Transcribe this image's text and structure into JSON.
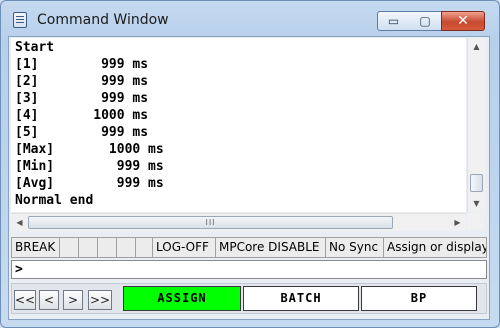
{
  "window": {
    "title": "Command Window",
    "controls": {
      "minimize": "▭",
      "maximize": "▢",
      "close": "✕"
    }
  },
  "output": {
    "lines": [
      "Start",
      "[1]        999 ms",
      "[2]        999 ms",
      "[3]        999 ms",
      "[4]       1000 ms",
      "[5]        999 ms",
      "[Max]       1000 ms",
      "[Min]        999 ms",
      "[Avg]        999 ms",
      "Normal end"
    ]
  },
  "scrollbars": {
    "up_arrow": "▲",
    "down_arrow": "▼",
    "left_arrow": "◀",
    "right_arrow": "▶",
    "grip": "III"
  },
  "status": {
    "state": "BREAK",
    "log": "LOG-OFF",
    "mpcore": "MPCore DISABLE",
    "sync": "No Sync",
    "hint": "Assign or display"
  },
  "command_line": {
    "prompt": ">",
    "value": ""
  },
  "buttons": {
    "nav_first": "<<",
    "nav_prev": "<",
    "nav_next": ">",
    "nav_last": ">>",
    "assign": "ASSIGN",
    "batch": "BATCH",
    "bp": "BP"
  },
  "colors": {
    "assign_active": "#00ff00",
    "close_button": "#c74a31"
  }
}
